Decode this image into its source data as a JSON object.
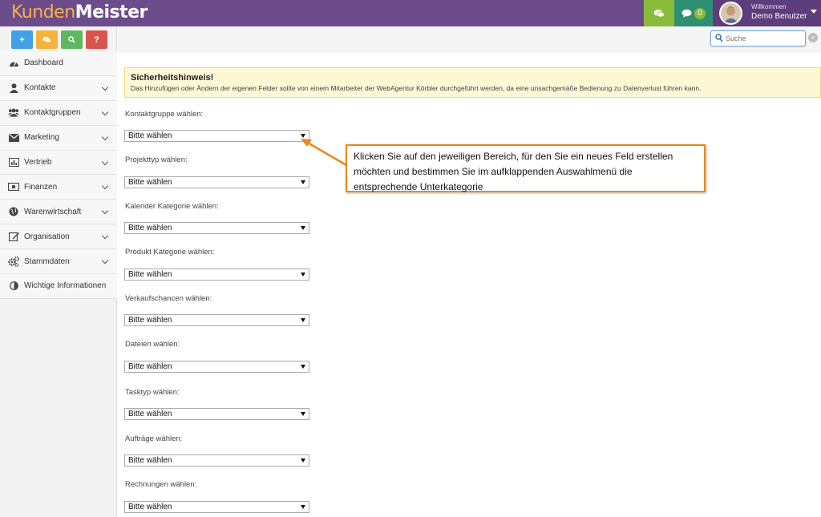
{
  "app": {
    "logo_part1": "Kunden",
    "logo_part2": "Meister"
  },
  "header": {
    "messages_count": "0",
    "welcome": "Willkommen",
    "username": "Demo Benutzer"
  },
  "quick_actions": [
    "+",
    "?"
  ],
  "search": {
    "placeholder": "Suche"
  },
  "sidebar": {
    "items": [
      {
        "label": "Dashboard",
        "icon": "dashboard-icon"
      },
      {
        "label": "Kontakte",
        "icon": "user-icon"
      },
      {
        "label": "Kontaktgruppen",
        "icon": "users-icon"
      },
      {
        "label": "Marketing",
        "icon": "envelope-icon"
      },
      {
        "label": "Vertrieb",
        "icon": "bar-chart-icon"
      },
      {
        "label": "Finanzen",
        "icon": "money-icon"
      },
      {
        "label": "Warenwirtschaft",
        "icon": "globe-icon"
      },
      {
        "label": "Organisation",
        "icon": "edit-icon"
      },
      {
        "label": "Stammdaten",
        "icon": "cogs-icon"
      },
      {
        "label": "Wichtige Informationen",
        "icon": "contrast-icon"
      }
    ]
  },
  "warning": {
    "title": "Sicherheitshinweis!",
    "text": "Das Hinzufügen oder Ändern der eigenen Felder sollte von einem Mitarbeiter der WebAgentur Körbler durchgeführt werden, da eine unsachgemäße Bedienung zu Datenverlust führen kann."
  },
  "fields": [
    {
      "label": "Kontaktgruppe wählen:",
      "value": "Bitte wählen"
    },
    {
      "label": "Projekttyp wählen:",
      "value": "Bitte wählen"
    },
    {
      "label": "Kalender Kategorie wählen:",
      "value": "Bitte wählen"
    },
    {
      "label": "Produkt Kategorie wählen:",
      "value": "Bitte wählen"
    },
    {
      "label": "Verkaufschancen wählen:",
      "value": "Bitte wählen"
    },
    {
      "label": "Dateien wählen:",
      "value": "Bitte wählen"
    },
    {
      "label": "Tasktyp wählen:",
      "value": "Bitte wählen"
    },
    {
      "label": "Aufträge wählen:",
      "value": "Bitte wählen"
    },
    {
      "label": "Rechnungen wählen:",
      "value": "Bitte wählen"
    }
  ],
  "callout": {
    "line1": "Klicken Sie auf den jeweiligen Bereich, für den Sie ein neues Feld erstellen",
    "line2": "möchten und bestimmen Sie im aufklappenden Auswahlmenü die",
    "line3": "entsprechende  Unterkategorie"
  },
  "colors": {
    "header": "#6d4c8c",
    "accent_orange": "#e9891e",
    "warning_bg": "#fcf8d6"
  }
}
